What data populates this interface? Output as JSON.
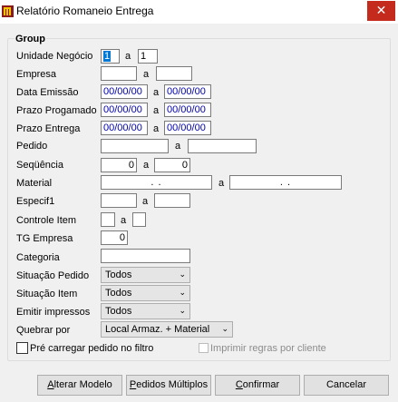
{
  "window": {
    "title": "Relatório Romaneio Entrega",
    "close_glyph": "✕"
  },
  "group": {
    "title": "Group"
  },
  "fields": {
    "unidade": {
      "label": "Unidade Negócio",
      "from": "1",
      "to": "1"
    },
    "empresa": {
      "label": "Empresa",
      "from": "",
      "to": ""
    },
    "data_emissao": {
      "label": "Data Emissão",
      "from": "00/00/00",
      "to": "00/00/00"
    },
    "prazo_programado": {
      "label": "Prazo Progamado",
      "from": "00/00/00",
      "to": "00/00/00"
    },
    "prazo_entrega": {
      "label": "Prazo Entrega",
      "from": "00/00/00",
      "to": "00/00/00"
    },
    "pedido": {
      "label": "Pedido",
      "from": "",
      "to": ""
    },
    "sequencia": {
      "label": "Seqüência",
      "from": "0",
      "to": "0"
    },
    "material": {
      "label": "Material",
      "from": ".  .",
      "to": ".  ."
    },
    "especif1": {
      "label": "Especif1",
      "from": "",
      "to": ""
    },
    "controle_item": {
      "label": "Controle Item",
      "from": "",
      "to": ""
    },
    "tg_empresa": {
      "label": "TG Empresa",
      "value": "0"
    },
    "categoria": {
      "label": "Categoria",
      "value": ""
    }
  },
  "range_sep": "a",
  "combos": {
    "situacao_pedido": {
      "label": "Situação Pedido",
      "value": "Todos"
    },
    "situacao_item": {
      "label": "Situação Item",
      "value": "Todos"
    },
    "emitir_impressos": {
      "label": "Emitir impressos",
      "value": "Todos"
    },
    "quebrar_por": {
      "label": "Quebrar por",
      "value": "Local Armaz. + Material"
    }
  },
  "checkboxes": {
    "pre_carregar": {
      "label": "Pré carregar pedido no filtro",
      "checked": false
    },
    "imprimir_regras": {
      "label": "Imprimir regras por cliente",
      "checked": false,
      "enabled": false
    }
  },
  "buttons": {
    "alterar_modelo": {
      "accel": "A",
      "rest": "lterar Modelo"
    },
    "pedidos_multiplos": {
      "accel": "P",
      "rest": "edidos Múltiplos"
    },
    "confirmar": {
      "accel": "C",
      "rest": "onfirmar"
    },
    "cancelar": {
      "accel": "",
      "rest": "Cancelar"
    }
  },
  "icons": {
    "app": "app-logo-icon",
    "close": "close-icon",
    "dropdown": "chevron-down-icon"
  },
  "colors": {
    "selection": "#0078d7",
    "date_text": "#0000aa",
    "close_bg": "#c42b1c"
  }
}
